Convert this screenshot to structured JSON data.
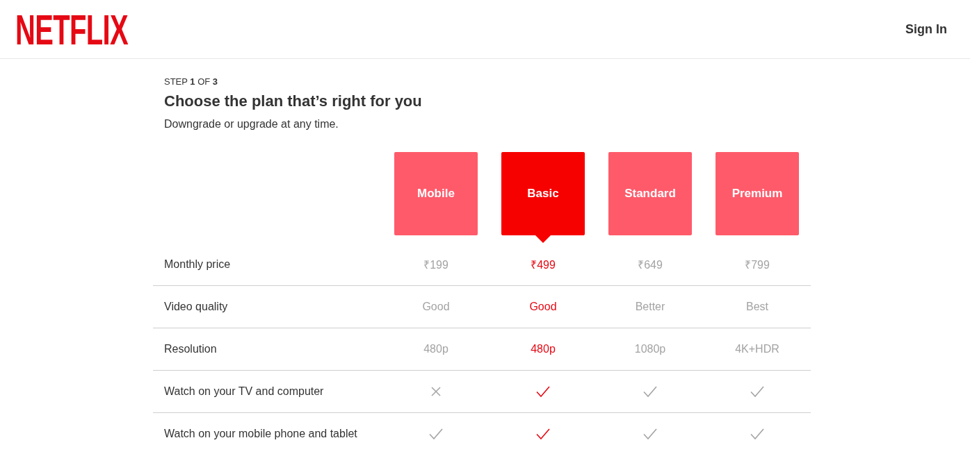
{
  "header": {
    "logo": "NETFLIX",
    "sign_in": "Sign In"
  },
  "intro": {
    "step": "STEP **1** OF **3**",
    "title": "Choose the plan that’s right for you",
    "subtitle": "Downgrade or upgrade at any time."
  },
  "plans": [
    {
      "name": "Mobile",
      "selected": false
    },
    {
      "name": "Basic",
      "selected": true
    },
    {
      "name": "Standard",
      "selected": false
    },
    {
      "name": "Premium",
      "selected": false
    }
  ],
  "features": [
    {
      "label": "Monthly price",
      "kind": "text",
      "values": [
        "₹199",
        "₹499",
        "₹649",
        "₹799"
      ]
    },
    {
      "label": "Video quality",
      "kind": "text",
      "values": [
        "Good",
        "Good",
        "Better",
        "Best"
      ]
    },
    {
      "label": "Resolution",
      "kind": "text",
      "values": [
        "480p",
        "480p",
        "1080p",
        "4K+HDR"
      ]
    },
    {
      "label": "Watch on your TV and computer",
      "kind": "check",
      "included": [
        false,
        true,
        true,
        true
      ]
    },
    {
      "label": "Watch on your mobile phone and tablet",
      "kind": "check",
      "included": [
        true,
        true,
        true,
        true
      ]
    }
  ]
}
